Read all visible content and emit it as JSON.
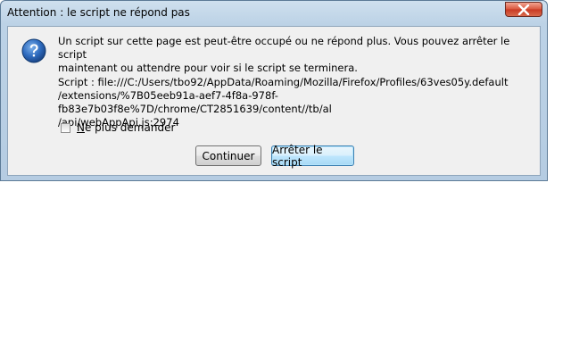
{
  "window": {
    "title": "Attention : le script ne répond pas",
    "close_icon": "close-x-icon"
  },
  "background_ghost_tabs": [
    "...",
    "...",
    "...",
    "..."
  ],
  "dialog": {
    "icon": "question-mark-icon",
    "icon_color": "#2a5fa8",
    "message_line1": "Un script sur cette page est peut-être occupé ou ne répond plus. Vous pouvez arrêter le script",
    "message_line2": "maintenant ou attendre pour voir si le script se terminera.",
    "script_line1": "Script : file:///C:/Users/tbo92/AppData/Roaming/Mozilla/Firefox/Profiles/63ves05y.default",
    "script_line2": "/extensions/%7B05eeb91a-aef7-4f8a-978f-fb83e7b03f8e%7D/chrome/CT2851639/content//tb/al",
    "script_line3": "/api/webAppApi.js:2974",
    "checkbox_label_mnemonic": "N",
    "checkbox_label_rest": "e plus demander",
    "checkbox_checked": false,
    "continue_label": "Continuer",
    "stop_label": "Arrêter le script"
  },
  "colors": {
    "titlebar_bg": "#bcd2e6",
    "close_button": "#c83a23",
    "focused_button_border": "#3c7fb1"
  }
}
